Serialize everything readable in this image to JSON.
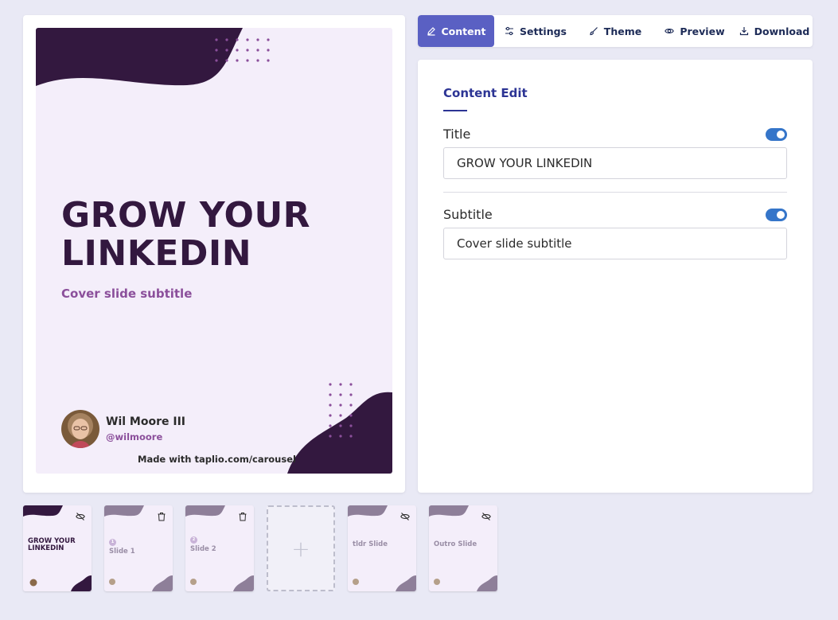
{
  "tabs": [
    {
      "label": "Content",
      "icon": "pencil-icon",
      "active": true
    },
    {
      "label": "Settings",
      "icon": "sliders-icon",
      "active": false
    },
    {
      "label": "Theme",
      "icon": "brush-icon",
      "active": false
    },
    {
      "label": "Preview",
      "icon": "eye-icon",
      "active": false
    },
    {
      "label": "Download",
      "icon": "download-icon",
      "active": false
    }
  ],
  "slide": {
    "title": "GROW YOUR LINKEDIN",
    "subtitle": "Cover slide subtitle",
    "author_name": "Wil Moore III",
    "author_handle": "@wilmoore",
    "made_with": "Made with taplio.com/carousel"
  },
  "content_edit": {
    "heading": "Content Edit",
    "title_label": "Title",
    "title_value": "GROW YOUR LINKEDIN",
    "title_enabled": true,
    "subtitle_label": "Subtitle",
    "subtitle_value": "Cover slide subtitle",
    "subtitle_enabled": true
  },
  "thumbnails": [
    {
      "title": "GROW YOUR LINKEDIN",
      "icon": "eye-off-icon"
    },
    {
      "title": "Slide 1",
      "number": "1",
      "icon": "trash-icon"
    },
    {
      "title": "Slide 2",
      "number": "2",
      "icon": "trash-icon"
    },
    {
      "title": "+",
      "icon": "plus-icon"
    },
    {
      "title": "tldr Slide",
      "icon": "eye-off-icon"
    },
    {
      "title": "Outro Slide",
      "icon": "eye-off-icon"
    }
  ],
  "colors": {
    "brand_dark": "#33183f",
    "accent_purple": "#8b4f9b",
    "tab_active": "#5a60c3",
    "heading_blue": "#2c3494",
    "toggle_blue": "#3575c9"
  }
}
